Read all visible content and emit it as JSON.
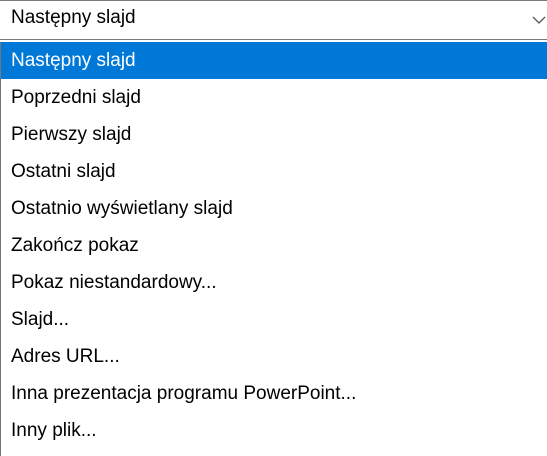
{
  "combo": {
    "value": "Następny slajd",
    "arrow_icon": "chevron-down-icon"
  },
  "list": {
    "items": [
      {
        "label": "Następny slajd",
        "selected": true
      },
      {
        "label": "Poprzedni slajd",
        "selected": false
      },
      {
        "label": "Pierwszy slajd",
        "selected": false
      },
      {
        "label": "Ostatni slajd",
        "selected": false
      },
      {
        "label": "Ostatnio wyświetlany slajd",
        "selected": false
      },
      {
        "label": "Zakończ pokaz",
        "selected": false
      },
      {
        "label": "Pokaz niestandardowy...",
        "selected": false
      },
      {
        "label": "Slajd...",
        "selected": false
      },
      {
        "label": "Adres URL...",
        "selected": false
      },
      {
        "label": "Inna prezentacja programu PowerPoint...",
        "selected": false
      },
      {
        "label": "Inny plik...",
        "selected": false
      }
    ]
  },
  "colors": {
    "selection": "#0078d7",
    "selected_text": "#ffffff",
    "text": "#000000"
  }
}
